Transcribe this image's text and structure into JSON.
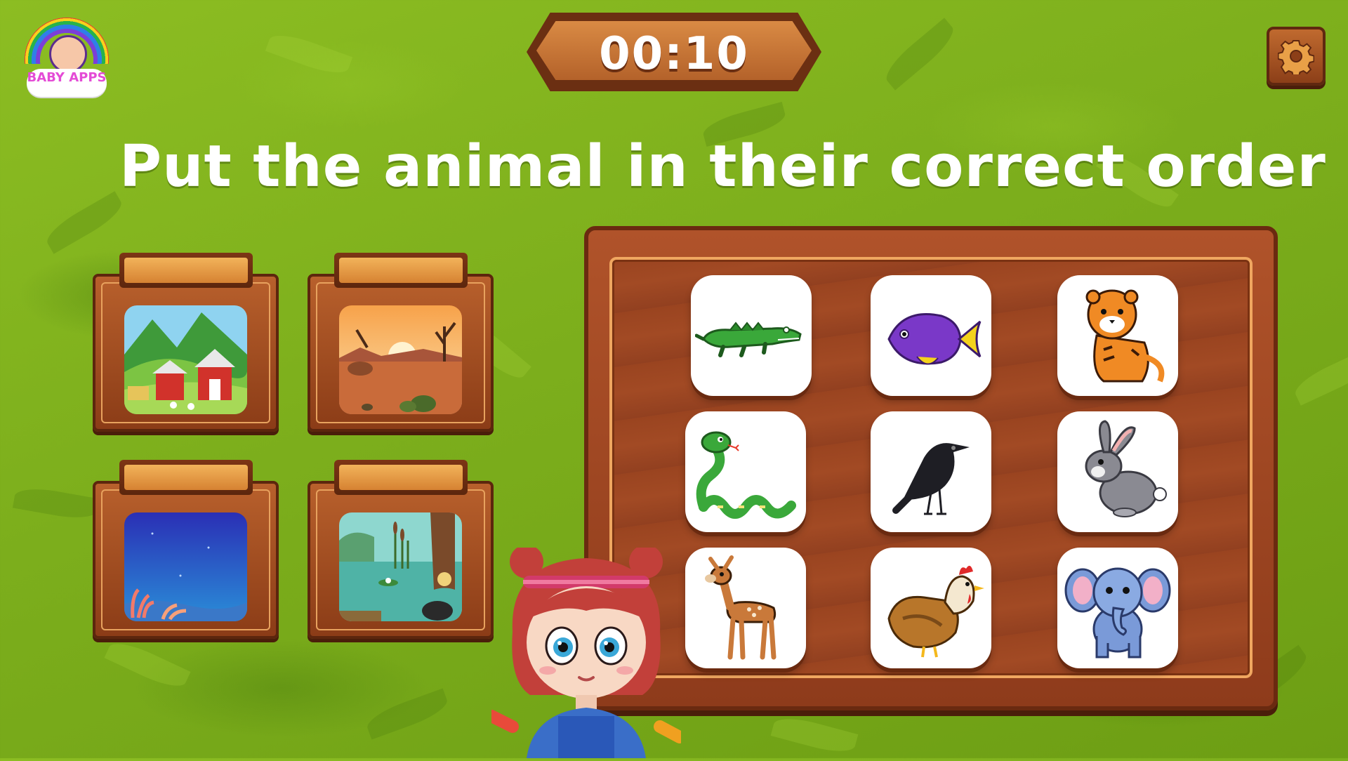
{
  "header": {
    "logo_text": "BABY APPS",
    "timer": "00:10"
  },
  "settings": {
    "icon": "gear-icon"
  },
  "instruction": "Put the animal in their correct order",
  "habitats": [
    {
      "name": "farm-habitat"
    },
    {
      "name": "desert-habitat"
    },
    {
      "name": "ocean-habitat"
    },
    {
      "name": "swamp-habitat"
    }
  ],
  "animal_cards": [
    {
      "name": "crocodile-card",
      "icon": "crocodile-icon"
    },
    {
      "name": "fish-card",
      "icon": "fish-icon"
    },
    {
      "name": "tiger-card",
      "icon": "tiger-icon"
    },
    {
      "name": "snake-card",
      "icon": "snake-icon"
    },
    {
      "name": "crow-card",
      "icon": "crow-icon"
    },
    {
      "name": "rabbit-card",
      "icon": "rabbit-icon"
    },
    {
      "name": "deer-card",
      "icon": "deer-icon"
    },
    {
      "name": "hen-card",
      "icon": "hen-icon"
    },
    {
      "name": "elephant-card",
      "icon": "elephant-icon"
    }
  ],
  "colors": {
    "grass": "#7cae1c",
    "wood": "#a24a24",
    "wood_dark": "#5c260d",
    "highlight": "#f0a760"
  }
}
